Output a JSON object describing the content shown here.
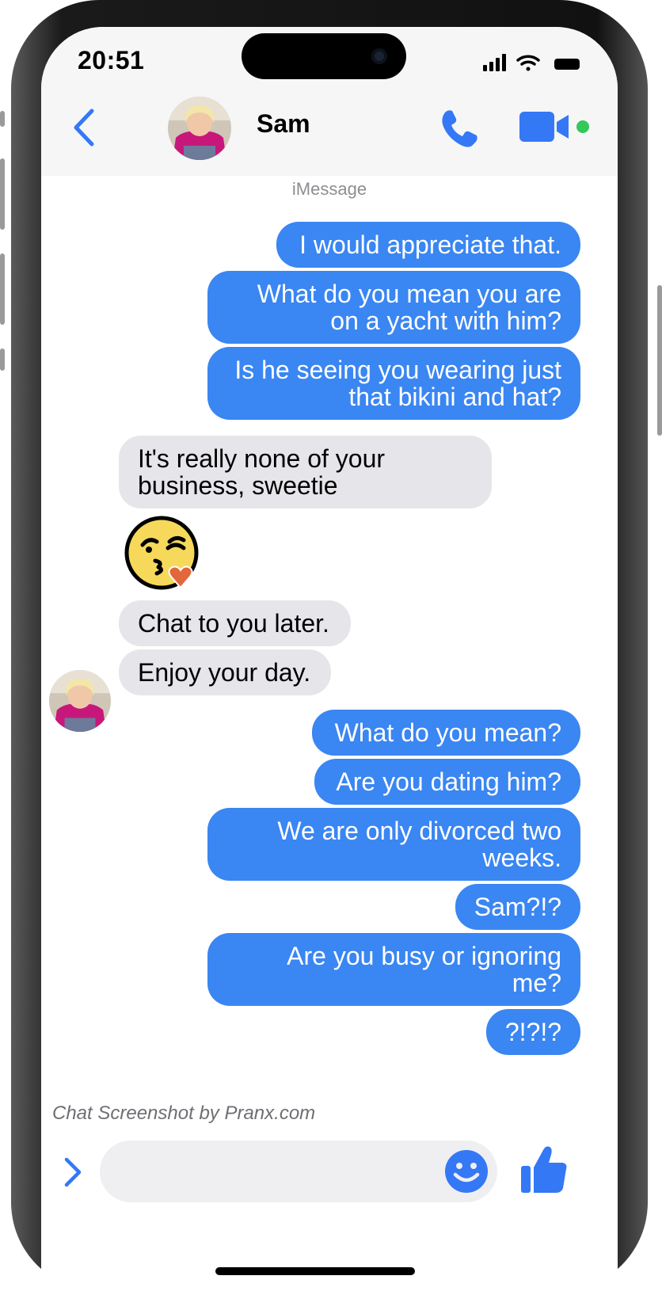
{
  "status_bar": {
    "time": "20:51"
  },
  "header": {
    "contact_name": "Sam"
  },
  "thread": {
    "service_label": "iMessage",
    "messages": [
      {
        "from": "me",
        "text": "I would appreciate that."
      },
      {
        "from": "me",
        "text": "What do you mean you are\non a yacht with him?"
      },
      {
        "from": "me",
        "text": "Is he seeing you wearing just\nthat bikini and hat?"
      },
      {
        "from": "contact",
        "text": "It's really none of your\nbusiness, sweetie"
      },
      {
        "from": "contact",
        "emoji": "face-blowing-a-kiss"
      },
      {
        "from": "contact",
        "text": "Chat to you later."
      },
      {
        "from": "contact",
        "text": "Enjoy your day."
      },
      {
        "from": "me",
        "text": "What do you mean?"
      },
      {
        "from": "me",
        "text": "Are you dating him?"
      },
      {
        "from": "me",
        "text": "We are only divorced two\nweeks."
      },
      {
        "from": "me",
        "text": "Sam?!?"
      },
      {
        "from": "me",
        "text": "Are you busy or ignoring\nme?"
      },
      {
        "from": "me",
        "text": "?!?!?"
      }
    ]
  },
  "watermark": "Chat Screenshot by Pranx.com",
  "colors": {
    "sent_bubble": "#3a86f2",
    "received_bubble": "#e5e5ea",
    "accent": "#3478f6",
    "online_dot": "#34c759"
  },
  "icons": [
    "back-chevron-icon",
    "phone-icon",
    "video-camera-icon",
    "chevron-right-icon",
    "smiley-icon",
    "thumbs-up-icon"
  ]
}
